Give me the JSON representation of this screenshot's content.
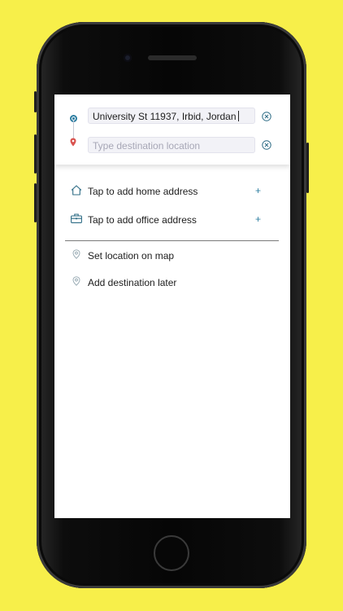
{
  "trip": {
    "origin_value": "University St 11937, Irbid, Jordan",
    "destination_placeholder": "Type destination location"
  },
  "saved_places": [
    {
      "label": "Tap to add home address",
      "icon": "home-icon",
      "action": "+"
    },
    {
      "label": "Tap to add office address",
      "icon": "briefcase-icon",
      "action": "+"
    }
  ],
  "options": [
    {
      "label": "Set location on map",
      "icon": "location-pin-icon"
    },
    {
      "label": "Add destination later",
      "icon": "location-pin-icon"
    }
  ],
  "colors": {
    "background": "#f7ef4a",
    "accent": "#2f7fa2",
    "destination_pin": "#d9534f"
  }
}
